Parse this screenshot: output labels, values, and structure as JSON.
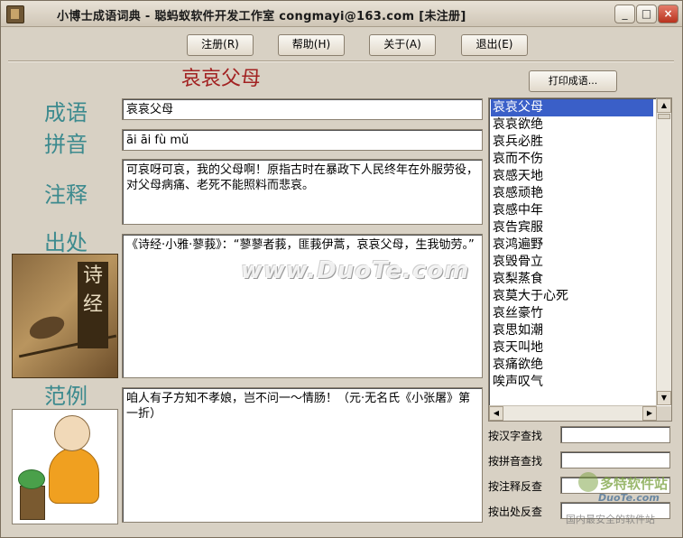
{
  "window": {
    "title": "小博士成语词典 - 聪蚂蚁软件开发工作室 congmayi@163.com [未注册]",
    "controls": {
      "minimize": "_",
      "maximize": "□",
      "close": "×"
    }
  },
  "toolbar": {
    "register": "注册(R)",
    "help": "帮助(H)",
    "about": "关于(A)",
    "exit": "退出(E)"
  },
  "headword": "哀哀父母",
  "print_button": "打印成语...",
  "labels": {
    "idiom": "成语",
    "pinyin": "拼音",
    "explanation": "注释",
    "source": "出处",
    "example": "范例"
  },
  "entry": {
    "idiom": "哀哀父母",
    "pinyin": "āi āi fù mǔ",
    "explanation": "可哀呀可哀，我的父母啊！原指古时在暴政下人民终年在外服劳役，对父母病痛、老死不能照料而悲哀。",
    "source": "《诗经·小雅·蓼莪》：“蓼蓼者莪，匪莪伊蒿，哀哀父母，生我劬劳。”",
    "example": "咱人有子方知不孝娘，岂不问一～情肠！（元·无名氏《小张屠》第一折）"
  },
  "book_image_text": "诗经",
  "idiom_list": {
    "items": [
      "哀哀父母",
      "哀哀欲绝",
      "哀兵必胜",
      "哀而不伤",
      "哀感天地",
      "哀感顽艳",
      "哀感中年",
      "哀告宾服",
      "哀鸿遍野",
      "哀毁骨立",
      "哀梨蒸食",
      "哀莫大于心死",
      "哀丝豪竹",
      "哀思如潮",
      "哀天叫地",
      "哀痛欲绝",
      "唉声叹气"
    ],
    "selected_index": 0
  },
  "search": {
    "by_char": "按汉字查找",
    "by_pinyin": "按拼音查找",
    "by_explanation": "按注释反查",
    "by_source": "按出处反查"
  },
  "watermarks": {
    "center": "www.DuoTe.com",
    "brand": "多特软件站",
    "url": "DuoTe.com",
    "slogan": "国内最安全的软件站"
  },
  "colors": {
    "headword": "#a22222",
    "labels": "#3c8a8e",
    "selection": "#3a5fc8",
    "close_button": "#c8422c"
  }
}
